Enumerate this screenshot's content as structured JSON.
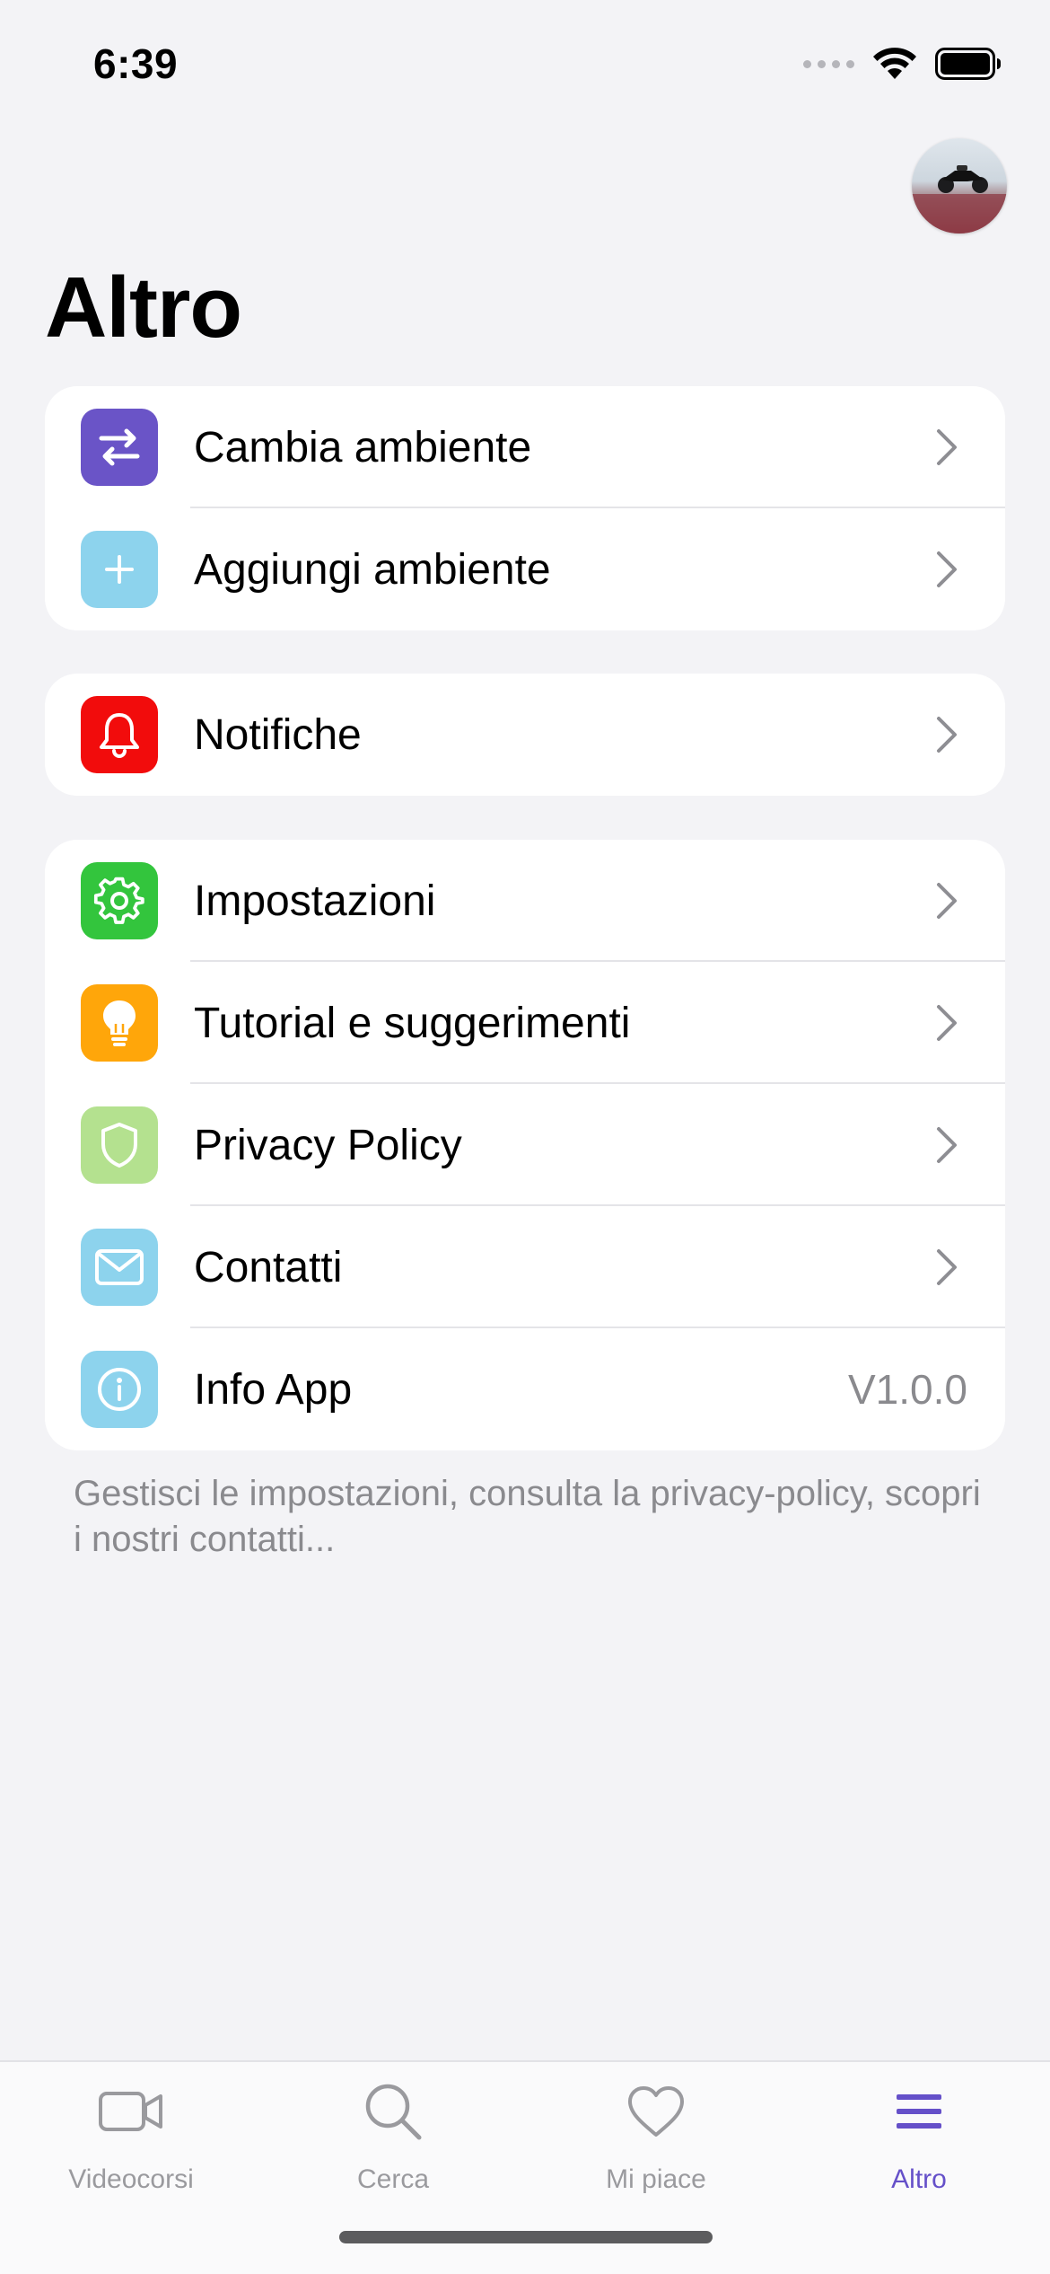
{
  "status": {
    "time": "6:39"
  },
  "header": {
    "title": "Altro"
  },
  "groups": [
    {
      "rows": [
        {
          "label": "Cambia ambiente",
          "icon": "swap-arrows-icon",
          "color": "#6a54c7"
        },
        {
          "label": "Aggiungi ambiente",
          "icon": "plus-icon",
          "color": "#8dd3ed"
        }
      ]
    },
    {
      "rows": [
        {
          "label": "Notifiche",
          "icon": "bell-icon",
          "color": "#f20c0c"
        }
      ]
    },
    {
      "rows": [
        {
          "label": "Impostazioni",
          "icon": "gear-icon",
          "color": "#33c53d"
        },
        {
          "label": "Tutorial e suggerimenti",
          "icon": "lightbulb-icon",
          "color": "#ffa60a"
        },
        {
          "label": "Privacy Policy",
          "icon": "shield-icon",
          "color": "#b4e18f"
        },
        {
          "label": "Contatti",
          "icon": "envelope-icon",
          "color": "#8dd3ed"
        },
        {
          "label": "Info App",
          "icon": "info-icon",
          "color": "#8dd3ed",
          "value": "V1.0.0"
        }
      ]
    }
  ],
  "footer": {
    "text": "Gestisci le impostazioni, consulta la privacy-policy, scopri i nostri contatti..."
  },
  "tabs": [
    {
      "label": "Videocorsi",
      "icon": "video-camera-icon"
    },
    {
      "label": "Cerca",
      "icon": "magnifier-icon"
    },
    {
      "label": "Mi piace",
      "icon": "heart-icon"
    },
    {
      "label": "Altro",
      "icon": "menu-lines-icon",
      "active": true
    }
  ],
  "colors": {
    "accent": "#6550c9",
    "background": "#f3f3f6",
    "secondary_text": "#8a8a8e"
  }
}
